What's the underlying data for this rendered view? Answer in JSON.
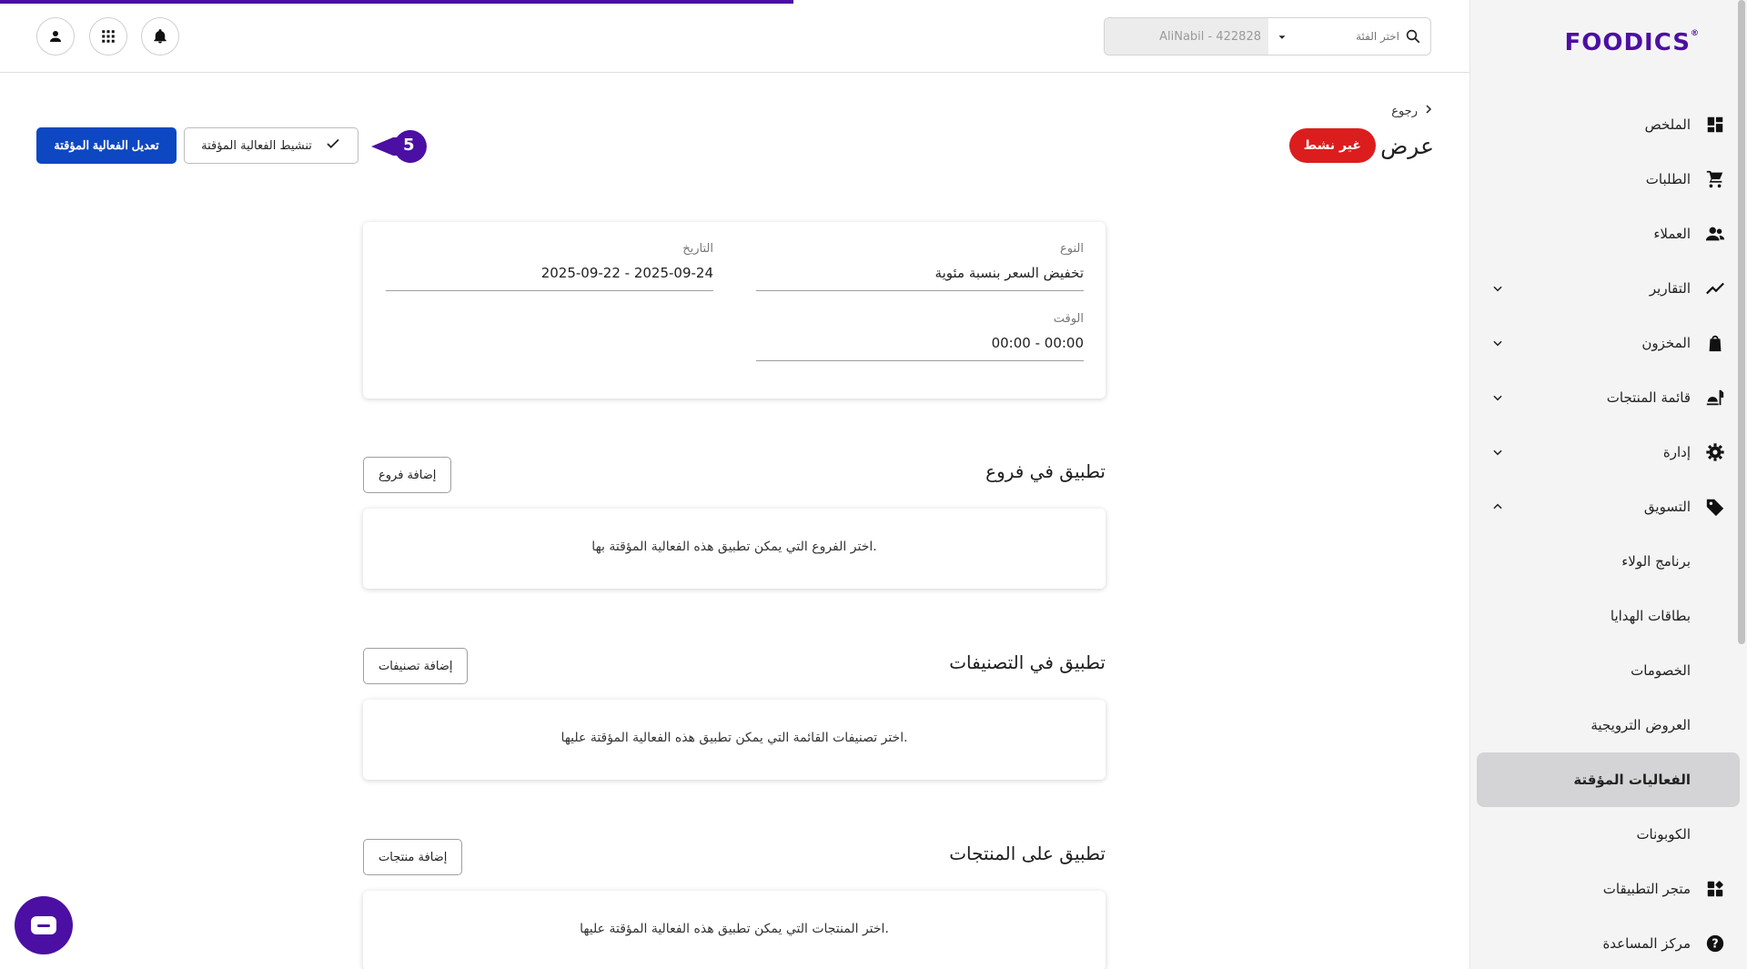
{
  "brand": {
    "logo_text": "FOODICS",
    "accent": "#4b0fa3",
    "primary_blue": "#0d47c1",
    "danger_red": "#dc1d1d"
  },
  "topbar": {
    "search_placeholder": "اختر الفئة",
    "account_value": "AliNabil - 422828",
    "icons": [
      "profile-icon",
      "apps-grid-icon",
      "notifications-icon"
    ]
  },
  "sidebar": {
    "items": [
      {
        "label": "الملخص",
        "icon": "dashboard-icon"
      },
      {
        "label": "الطلبات",
        "icon": "cart-icon"
      },
      {
        "label": "العملاء",
        "icon": "people-icon"
      },
      {
        "label": "التقارير",
        "icon": "trend-icon"
      },
      {
        "label": "المخزون",
        "icon": "bag-icon"
      },
      {
        "label": "قائمة المنتجات",
        "icon": "menu-food-icon"
      },
      {
        "label": "إدارة",
        "icon": "gear-icon"
      },
      {
        "label": "التسويق",
        "icon": "tag-icon"
      },
      {
        "label": "برنامج الولاء"
      },
      {
        "label": "بطاقات الهدايا"
      },
      {
        "label": "الخصومات"
      },
      {
        "label": "العروض الترويجية"
      },
      {
        "label": "الفعاليات المؤقتة"
      },
      {
        "label": "الكوبونات"
      },
      {
        "label": "متجر التطبيقات",
        "icon": "apps-store-icon"
      },
      {
        "label": "مركز المساعدة",
        "icon": "help-icon"
      }
    ]
  },
  "header": {
    "back_label": "رجوع",
    "title": "عرض",
    "status": "غير نشط",
    "edit_button": "تعديل الفعالية المؤقتة",
    "activate_button": "تنشيط الفعالية المؤقتة",
    "step_number": "5"
  },
  "details": {
    "type_label": "النوع",
    "type_value": "تخفيض السعر بنسبة مئوية",
    "date_label": "التاريخ",
    "date_value": "2025-09-22 - 2025-09-24",
    "time_label": "الوقت",
    "time_value": "00:00 - 00:00"
  },
  "sections": [
    {
      "title": "تطبيق في فروع",
      "button": "إضافة فروع",
      "message": "اختر الفروع التي يمكن تطبيق هذه الفعالية المؤقتة بها."
    },
    {
      "title": "تطبيق في التصنيفات",
      "button": "إضافة تصنيفات",
      "message": "اختر تصنيفات القائمة التي يمكن تطبيق هذه الفعالية المؤقتة عليها."
    },
    {
      "title": "تطبيق على المنتجات",
      "button": "إضافة منتجات",
      "message": "اختر المنتجات التي يمكن تطبيق هذه الفعالية المؤقتة عليها."
    }
  ]
}
